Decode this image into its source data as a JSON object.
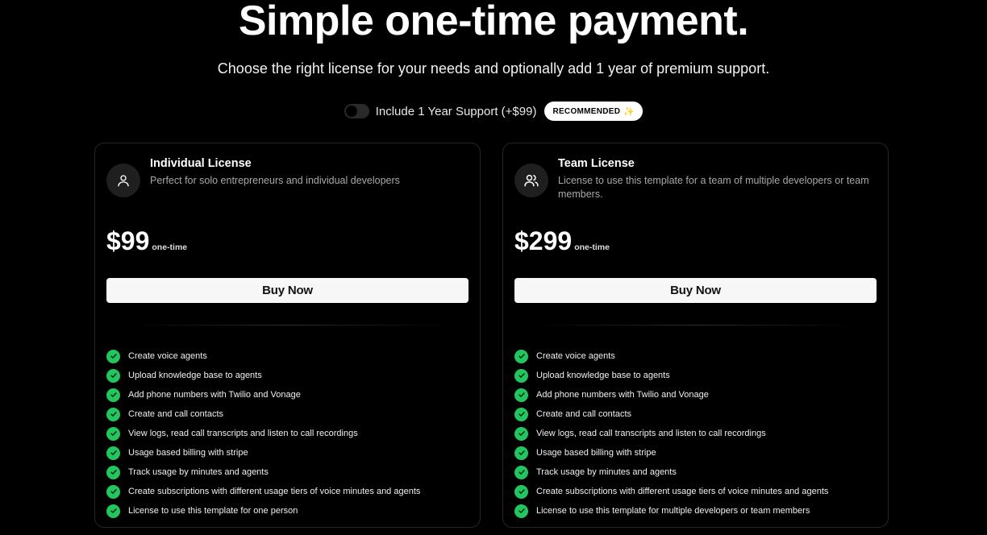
{
  "hero": {
    "title": "Simple one-time payment.",
    "subtitle": "Choose the right license for your needs and optionally add 1 year of premium support."
  },
  "support_toggle": {
    "label": "Include 1 Year Support (+$99)",
    "enabled": false,
    "badge": "RECOMMENDED",
    "badge_icon": "sparkle-icon"
  },
  "plans": [
    {
      "name": "Individual License",
      "description": "Perfect for solo entrepreneurs and individual developers",
      "icon": "user-icon",
      "price": "$99",
      "price_unit": "one-time",
      "cta": "Buy Now",
      "features": [
        "Create voice agents",
        "Upload knowledge base to agents",
        "Add phone numbers with Twilio and Vonage",
        "Create and call contacts",
        "View logs, read call transcripts and listen to call recordings",
        "Usage based billing with stripe",
        "Track usage by minutes and agents",
        "Create subscriptions with different usage tiers of voice minutes and agents",
        "License to use this template for one person"
      ]
    },
    {
      "name": "Team License",
      "description": "License to use this template for a team of multiple developers or team members.",
      "icon": "users-icon",
      "price": "$299",
      "price_unit": "one-time",
      "cta": "Buy Now",
      "features": [
        "Create voice agents",
        "Upload knowledge base to agents",
        "Add phone numbers with Twilio and Vonage",
        "Create and call contacts",
        "View logs, read call transcripts and listen to call recordings",
        "Usage based billing with stripe",
        "Track usage by minutes and agents",
        "Create subscriptions with different usage tiers of voice minutes and agents",
        "License to use this template for multiple developers or team members"
      ]
    }
  ],
  "colors": {
    "background": "#000000",
    "check": "#22c55e",
    "button": "#f7f7f7"
  }
}
